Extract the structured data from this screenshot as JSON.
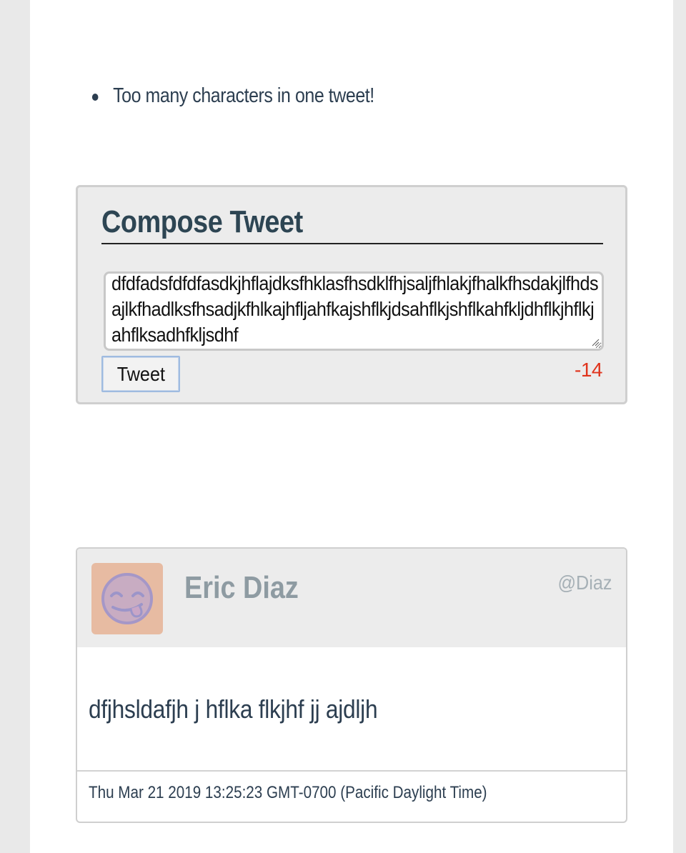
{
  "errors": [
    "Too many characters in one tweet!"
  ],
  "compose": {
    "title": "Compose Tweet",
    "text_value": "dfdfadsfdfdfasdkjhflajdksfhklasfhsdklfhjsaljfhlakjfhalkfhsdakjlfhdsajlkfhadlksfhsadjkfhlkajhfljahfkajshflkjdsahflkjshflkahfkljdhflkjhflkjahflksadhfkljsdhf",
    "button_label": "Tweet",
    "char_remaining": "-14",
    "counter_color": "#e0341d"
  },
  "tweet": {
    "author_name": "Eric Diaz",
    "handle": "@Diaz",
    "avatar_icon": "tongue-out-smiley-icon",
    "body": "dfjhsldafjh j hflka flkjhf jj ajdljh",
    "timestamp": "Thu Mar 21 2019 13:25:23 GMT-0700 (Pacific Daylight Time)"
  },
  "colors": {
    "page_bg": "#e9e9e9",
    "card_bg": "#ececec",
    "text": "#2c3e50",
    "muted_name": "#8e9ba2"
  }
}
